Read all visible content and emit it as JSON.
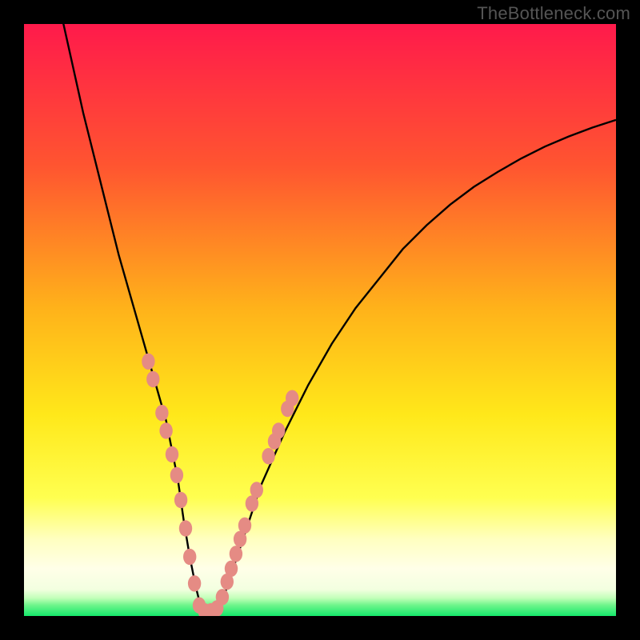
{
  "attribution": "TheBottleneck.com",
  "colors": {
    "page_bg": "#000000",
    "gradient_top": "#ff1a4b",
    "gradient_mid_upper": "#ff6a2a",
    "gradient_mid": "#ffd21a",
    "gradient_mid_lower": "#ffff3a",
    "gradient_pale": "#ffffdc",
    "gradient_bottom": "#15e86b",
    "curve_stroke": "#000000",
    "dot_fill": "#e58b84"
  },
  "chart_data": {
    "type": "line",
    "title": "",
    "xlabel": "",
    "ylabel": "",
    "xlim": [
      0,
      100
    ],
    "ylim": [
      0,
      100
    ],
    "series": [
      {
        "name": "bottleneck-curve",
        "x": [
          6,
          8,
          10,
          12,
          14,
          16,
          18,
          20,
          22,
          24,
          26,
          27,
          28,
          29,
          30,
          32,
          34,
          36,
          38,
          40,
          44,
          48,
          52,
          56,
          60,
          64,
          68,
          72,
          76,
          80,
          84,
          88,
          92,
          96,
          100
        ],
        "y": [
          103,
          94,
          85,
          77,
          69,
          61,
          54,
          47,
          40,
          33,
          23,
          16,
          10,
          5,
          1,
          1,
          4,
          10,
          16,
          22,
          31,
          39,
          46,
          52,
          57,
          62,
          66,
          69.5,
          72.5,
          75,
          77.3,
          79.3,
          81,
          82.5,
          83.8
        ]
      }
    ],
    "annotations": {
      "left_cluster_dots": [
        {
          "x": 21.0,
          "y": 43.0
        },
        {
          "x": 21.8,
          "y": 40.0
        },
        {
          "x": 23.3,
          "y": 34.3
        },
        {
          "x": 24.0,
          "y": 31.3
        },
        {
          "x": 25.0,
          "y": 27.3
        },
        {
          "x": 25.8,
          "y": 23.8
        },
        {
          "x": 26.5,
          "y": 19.6
        },
        {
          "x": 27.3,
          "y": 14.8
        },
        {
          "x": 28.0,
          "y": 10.0
        },
        {
          "x": 28.8,
          "y": 5.5
        }
      ],
      "bottom_cluster_dots": [
        {
          "x": 29.6,
          "y": 1.8
        },
        {
          "x": 30.5,
          "y": 0.8
        },
        {
          "x": 31.6,
          "y": 0.8
        },
        {
          "x": 32.6,
          "y": 1.3
        }
      ],
      "right_cluster_dots": [
        {
          "x": 33.5,
          "y": 3.2
        },
        {
          "x": 34.3,
          "y": 5.8
        },
        {
          "x": 35.0,
          "y": 8.0
        },
        {
          "x": 35.8,
          "y": 10.5
        },
        {
          "x": 36.5,
          "y": 13.0
        },
        {
          "x": 37.3,
          "y": 15.3
        },
        {
          "x": 38.5,
          "y": 19.0
        },
        {
          "x": 39.3,
          "y": 21.3
        },
        {
          "x": 41.3,
          "y": 27.0
        },
        {
          "x": 42.3,
          "y": 29.5
        },
        {
          "x": 43.0,
          "y": 31.3
        },
        {
          "x": 44.5,
          "y": 35.0
        },
        {
          "x": 45.3,
          "y": 36.8
        }
      ]
    },
    "gradient_bands": [
      {
        "y_start": 100,
        "y_end": 20,
        "from": "gradient_top",
        "to": "gradient_mid"
      },
      {
        "y_start": 20,
        "y_end": 10,
        "from": "gradient_mid",
        "to": "gradient_pale"
      },
      {
        "y_start": 10,
        "y_end": 2,
        "from": "gradient_pale",
        "to": "gradient_pale"
      },
      {
        "y_start": 2,
        "y_end": 0,
        "from": "gradient_pale",
        "to": "gradient_bottom"
      }
    ]
  }
}
